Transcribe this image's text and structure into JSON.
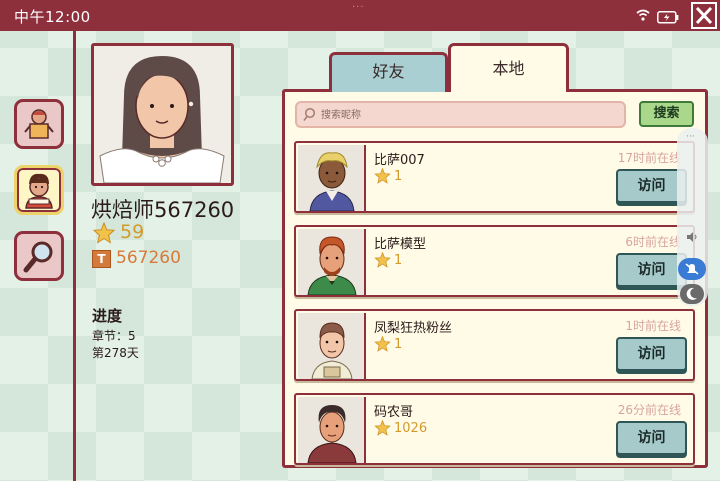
{
  "status_bar": {
    "time": "中午12:00",
    "grab_dots": "···"
  },
  "colors": {
    "maroon": "#8e2f3c",
    "star": "#d39a2a",
    "coin": "#d9793a",
    "online": "#d7a4a0"
  },
  "sidebar": [
    {
      "name": "recipes-icon"
    },
    {
      "name": "profile-icon",
      "active": true
    },
    {
      "name": "magnifier-icon"
    }
  ],
  "profile": {
    "name": "烘焙师567260",
    "stars": "59",
    "coins": "567260",
    "coin_glyph": "T",
    "progress_title": "进度",
    "chapter": "章节：5",
    "day": "第278天"
  },
  "tabs": {
    "friends": "好友",
    "local": "本地"
  },
  "search": {
    "placeholder": "搜索昵称",
    "button": "搜索"
  },
  "players": [
    {
      "name": "比萨007",
      "stars": "1",
      "last_online": "17时前在线",
      "visit": "访问"
    },
    {
      "name": "比萨模型",
      "stars": "1",
      "last_online": "6时前在线",
      "visit": "访问"
    },
    {
      "name": "凤梨狂热粉丝",
      "stars": "1",
      "last_online": "1时前在线",
      "visit": "访问"
    },
    {
      "name": "码农哥",
      "stars": "1026",
      "last_online": "26分前在线",
      "visit": "访问"
    }
  ],
  "overlay": {
    "dots": "···"
  }
}
